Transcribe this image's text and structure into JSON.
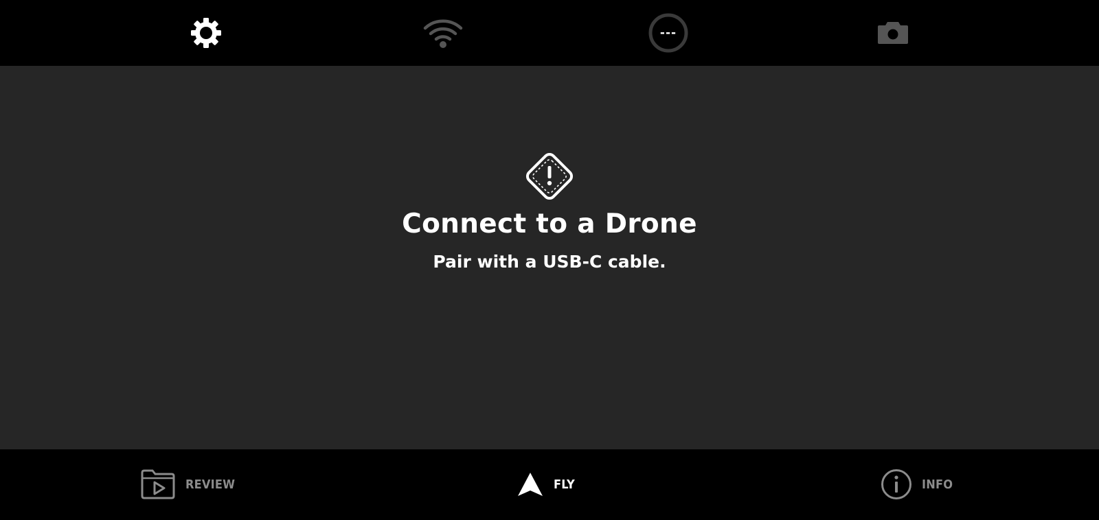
{
  "top_bar": {
    "icons": {
      "settings": "gear-icon",
      "wifi": "wifi-icon",
      "status": "status-ring-icon",
      "camera": "camera-icon"
    },
    "status_value": "---"
  },
  "main": {
    "icon": "warning-diamond-icon",
    "title": "Connect to a Drone",
    "subtitle": "Pair with a USB-C cable."
  },
  "bottom_nav": {
    "items": [
      {
        "label": "REVIEW",
        "icon": "folder-play-icon",
        "active": false
      },
      {
        "label": "FLY",
        "icon": "arrow-up-icon",
        "active": true
      },
      {
        "label": "INFO",
        "icon": "info-icon",
        "active": false
      }
    ]
  },
  "colors": {
    "bar_background": "#000000",
    "main_background": "#262626",
    "active": "#ffffff",
    "inactive": "#8c8c8c",
    "disabled_icon": "#555555"
  }
}
